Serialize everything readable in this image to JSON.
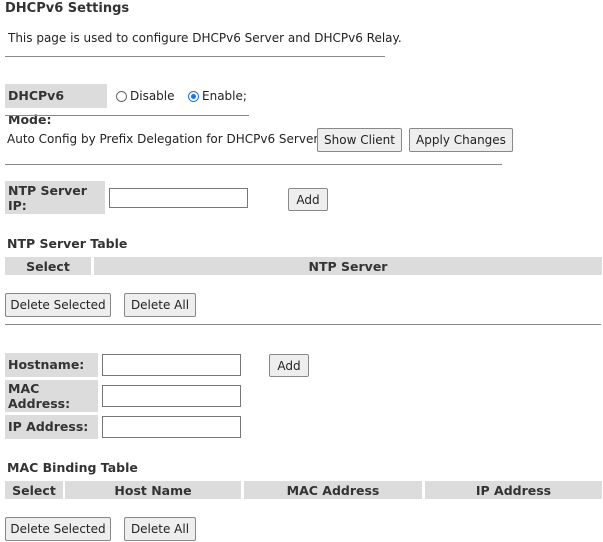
{
  "page": {
    "title": "DHCPv6 Settings",
    "description": "This page is used to configure DHCPv6 Server and DHCPv6 Relay."
  },
  "mode": {
    "label": "DHCPv6 Mode:",
    "options": [
      "Disable",
      "Enable;"
    ],
    "selected": "Enable;"
  },
  "auto_config": {
    "text": "Auto Config by Prefix Delegation for DHCPv6 Server.",
    "show_client_label": "Show Client",
    "apply_changes_label": "Apply Changes"
  },
  "ntp": {
    "server_ip_label": "NTP Server IP:",
    "server_ip_value": "",
    "add_label": "Add",
    "table_title": "NTP Server Table",
    "columns": [
      "Select",
      "NTP Server"
    ],
    "delete_selected_label": "Delete Selected",
    "delete_all_label": "Delete All"
  },
  "binding": {
    "hostname_label": "Hostname:",
    "mac_label": "MAC Address:",
    "ip_label": "IP Address:",
    "add_label": "Add",
    "table_title": "MAC Binding Table",
    "columns": [
      "Select",
      "Host Name",
      "MAC Address",
      "IP Address"
    ],
    "delete_selected_label": "Delete Selected",
    "delete_all_label": "Delete All"
  }
}
